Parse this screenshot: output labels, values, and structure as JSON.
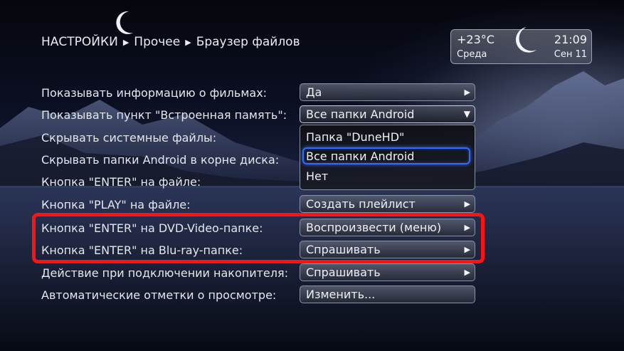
{
  "breadcrumb": {
    "items": [
      "НАСТРОЙКИ",
      "Прочее",
      "Браузер файлов"
    ],
    "separator": "▶"
  },
  "weather": {
    "temperature": "+23°C",
    "time": "21:09",
    "day": "Среда",
    "date": "Сен 11",
    "icon": "crescent-moon-icon"
  },
  "settings": [
    {
      "label": "Показывать информацию о фильмах:",
      "value": "Да"
    },
    {
      "label": "Показывать пункт \"Встроенная память\":",
      "value": "Все папки Android"
    },
    {
      "label": "Скрывать системные файлы:",
      "value": ""
    },
    {
      "label": "Скрывать папки Android в корне диска:",
      "value": ""
    },
    {
      "label": "Кнопка \"ENTER\" на файле:",
      "value": ""
    },
    {
      "label": "Кнопка \"PLAY\" на файле:",
      "value": "Создать плейлист"
    },
    {
      "label": "Кнопка \"ENTER\" на DVD-Video-папке:",
      "value": "Воспроизвести (меню)"
    },
    {
      "label": "Кнопка \"ENTER\" на Blu-ray-папке:",
      "value": "Спрашивать"
    },
    {
      "label": "Действие при подключении накопителя:",
      "value": "Спрашивать"
    },
    {
      "label": "Автоматические отметки о просмотре:",
      "value": "Изменить..."
    }
  ],
  "dropdown": {
    "options": [
      "Папка \"DuneHD\"",
      "Все папки Android",
      "Нет"
    ],
    "selected": "Все папки Android"
  },
  "icons": {
    "right": "▶",
    "down": "▼"
  },
  "colors": {
    "highlight_red": "#ff1212",
    "focus_blue": "#2f6bff"
  }
}
